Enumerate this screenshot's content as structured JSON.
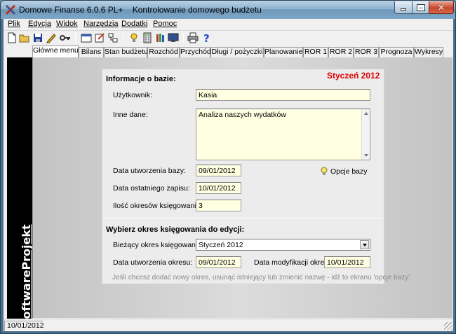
{
  "window": {
    "title": "Domowe Finanse 6.0.6 PL+    Kontrolowanie domowego budżetu",
    "close_glyph": "✕"
  },
  "menu": [
    "Plik",
    "Edycja",
    "Widok",
    "Narzędzia",
    "Dodatki",
    "Pomoc"
  ],
  "toolbar": {
    "icons": [
      "new-file-icon",
      "open-folder-icon",
      "save-icon",
      "edit-pen-icon",
      "key-icon",
      "window-icon",
      "edit-form-icon",
      "network-icon",
      "bulb-icon",
      "calculator-icon",
      "books-icon",
      "monitor-icon",
      "printer-icon",
      "help-icon"
    ]
  },
  "tabs": [
    "Główne menu",
    "Bilans",
    "Stan budżetu",
    "Rozchód",
    "Przychód",
    "Długi / pożyczki",
    "Planowanie",
    "ROR 1",
    "ROR 2",
    "ROR 3",
    "Prognoza",
    "Wykresy"
  ],
  "active_tab": "Główne menu",
  "sidebar": {
    "brand": "SoftwareProjekt"
  },
  "info": {
    "heading": "Informacje o bazie:",
    "month": "Styczeń 2012",
    "user_label": "Użytkownik:",
    "user_value": "Kasia",
    "other_label": "Inne dane:",
    "other_value": "Analiza naszych wydatków",
    "created_label": "Data utworzenia bazy:",
    "created_value": "09/01/2012",
    "last_save_label": "Data ostatniego zapisu:",
    "last_save_value": "10/01/2012",
    "periods_label": "Ilość okresów księgowania:",
    "periods_value": "3",
    "options_label": "Opcje bazy"
  },
  "period": {
    "heading": "Wybierz okres księgowania do edycji:",
    "current_label": "Bieżący okres księgowania:",
    "current_value": "Styczeń 2012",
    "created_label": "Data utworzenia okresu:",
    "created_value": "09/01/2012",
    "modified_label": "Data modyfikacji okresu:",
    "modified_value": "10/01/2012",
    "hint": "Jeśli chcesz dodać nowy okres, usunąć istniejący lub zmienić nazwę - idź to ekranu 'opcje bazy'"
  },
  "status": {
    "date": "10/01/2012"
  },
  "colors": {
    "accent_month": "#e00000",
    "field_bg": "#ffffe1",
    "sidebar_bg": "#000000"
  }
}
